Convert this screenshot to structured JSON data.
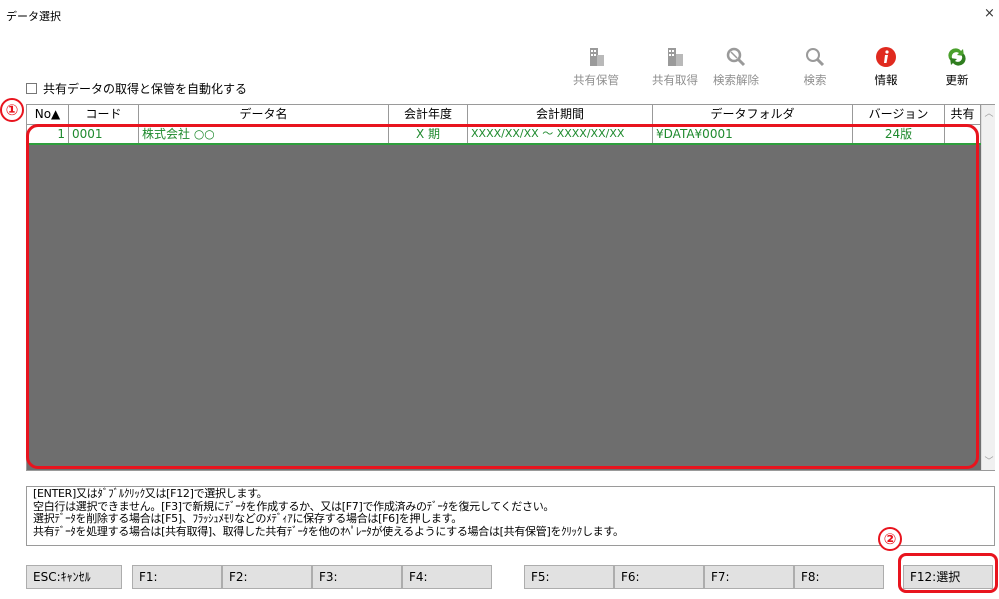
{
  "window": {
    "title": "データ選択",
    "close_glyph": "×"
  },
  "toolbar": {
    "buttons": [
      {
        "label": "共有保管",
        "icon": "share-store-icon",
        "enabled": false
      },
      {
        "label": "共有取得",
        "icon": "share-get-icon",
        "enabled": false
      },
      {
        "label": "検索解除",
        "icon": "search-clear-icon",
        "enabled": false
      },
      {
        "label": "検索",
        "icon": "search-icon",
        "enabled": false
      },
      {
        "label": "情報",
        "icon": "info-icon",
        "enabled": true
      },
      {
        "label": "更新",
        "icon": "refresh-icon",
        "enabled": true
      }
    ]
  },
  "auto_share": {
    "label": "共有データの取得と保管を自動化する",
    "checked": false
  },
  "grid": {
    "columns": [
      "No▲",
      "コード",
      "データ名",
      "会計年度",
      "会計期間",
      "データフォルダ",
      "バージョン",
      "共有"
    ],
    "rows": [
      {
        "no": "1",
        "code": "0001",
        "name": "株式会社 ○○",
        "year": "X 期",
        "period": "XXXX/XX/XX ～ XXXX/XX/XX",
        "folder": "¥DATA¥0001",
        "version": "24版",
        "shared": ""
      }
    ],
    "scroll_up": "︿",
    "scroll_down": "﹀"
  },
  "annotations": {
    "callout_1": "①",
    "callout_2": "②"
  },
  "messages": [
    "[ENTER]又はﾀﾞﾌﾞﾙｸﾘｯｸ又は[F12]で選択します。",
    "空白行は選択できません。[F3]で新規にﾃﾞｰﾀを作成するか、又は[F7]で作成済みのﾃﾞｰﾀを復元してください。",
    "選択ﾃﾞｰﾀを削除する場合は[F5]、ﾌﾗｯｼｭﾒﾓﾘなどのﾒﾃﾞｨｱに保存する場合は[F6]を押します。",
    "共有ﾃﾞｰﾀを処理する場合は[共有取得]、取得した共有ﾃﾞｰﾀを他のｵﾍﾟﾚｰﾀが使えるようにする場合は[共有保管]をｸﾘｯｸします。"
  ],
  "function_keys": {
    "esc": "ESC:ｷｬﾝｾﾙ",
    "f1": "F1:",
    "f2": "F2:",
    "f3": "F3:",
    "f4": "F4:",
    "f5": "F5:",
    "f6": "F6:",
    "f7": "F7:",
    "f8": "F8:",
    "f12": "F12:選択"
  },
  "colors": {
    "highlight": "#e8141e",
    "selected_text": "#1f8a2e",
    "grid_empty": "#6e6e6e"
  }
}
